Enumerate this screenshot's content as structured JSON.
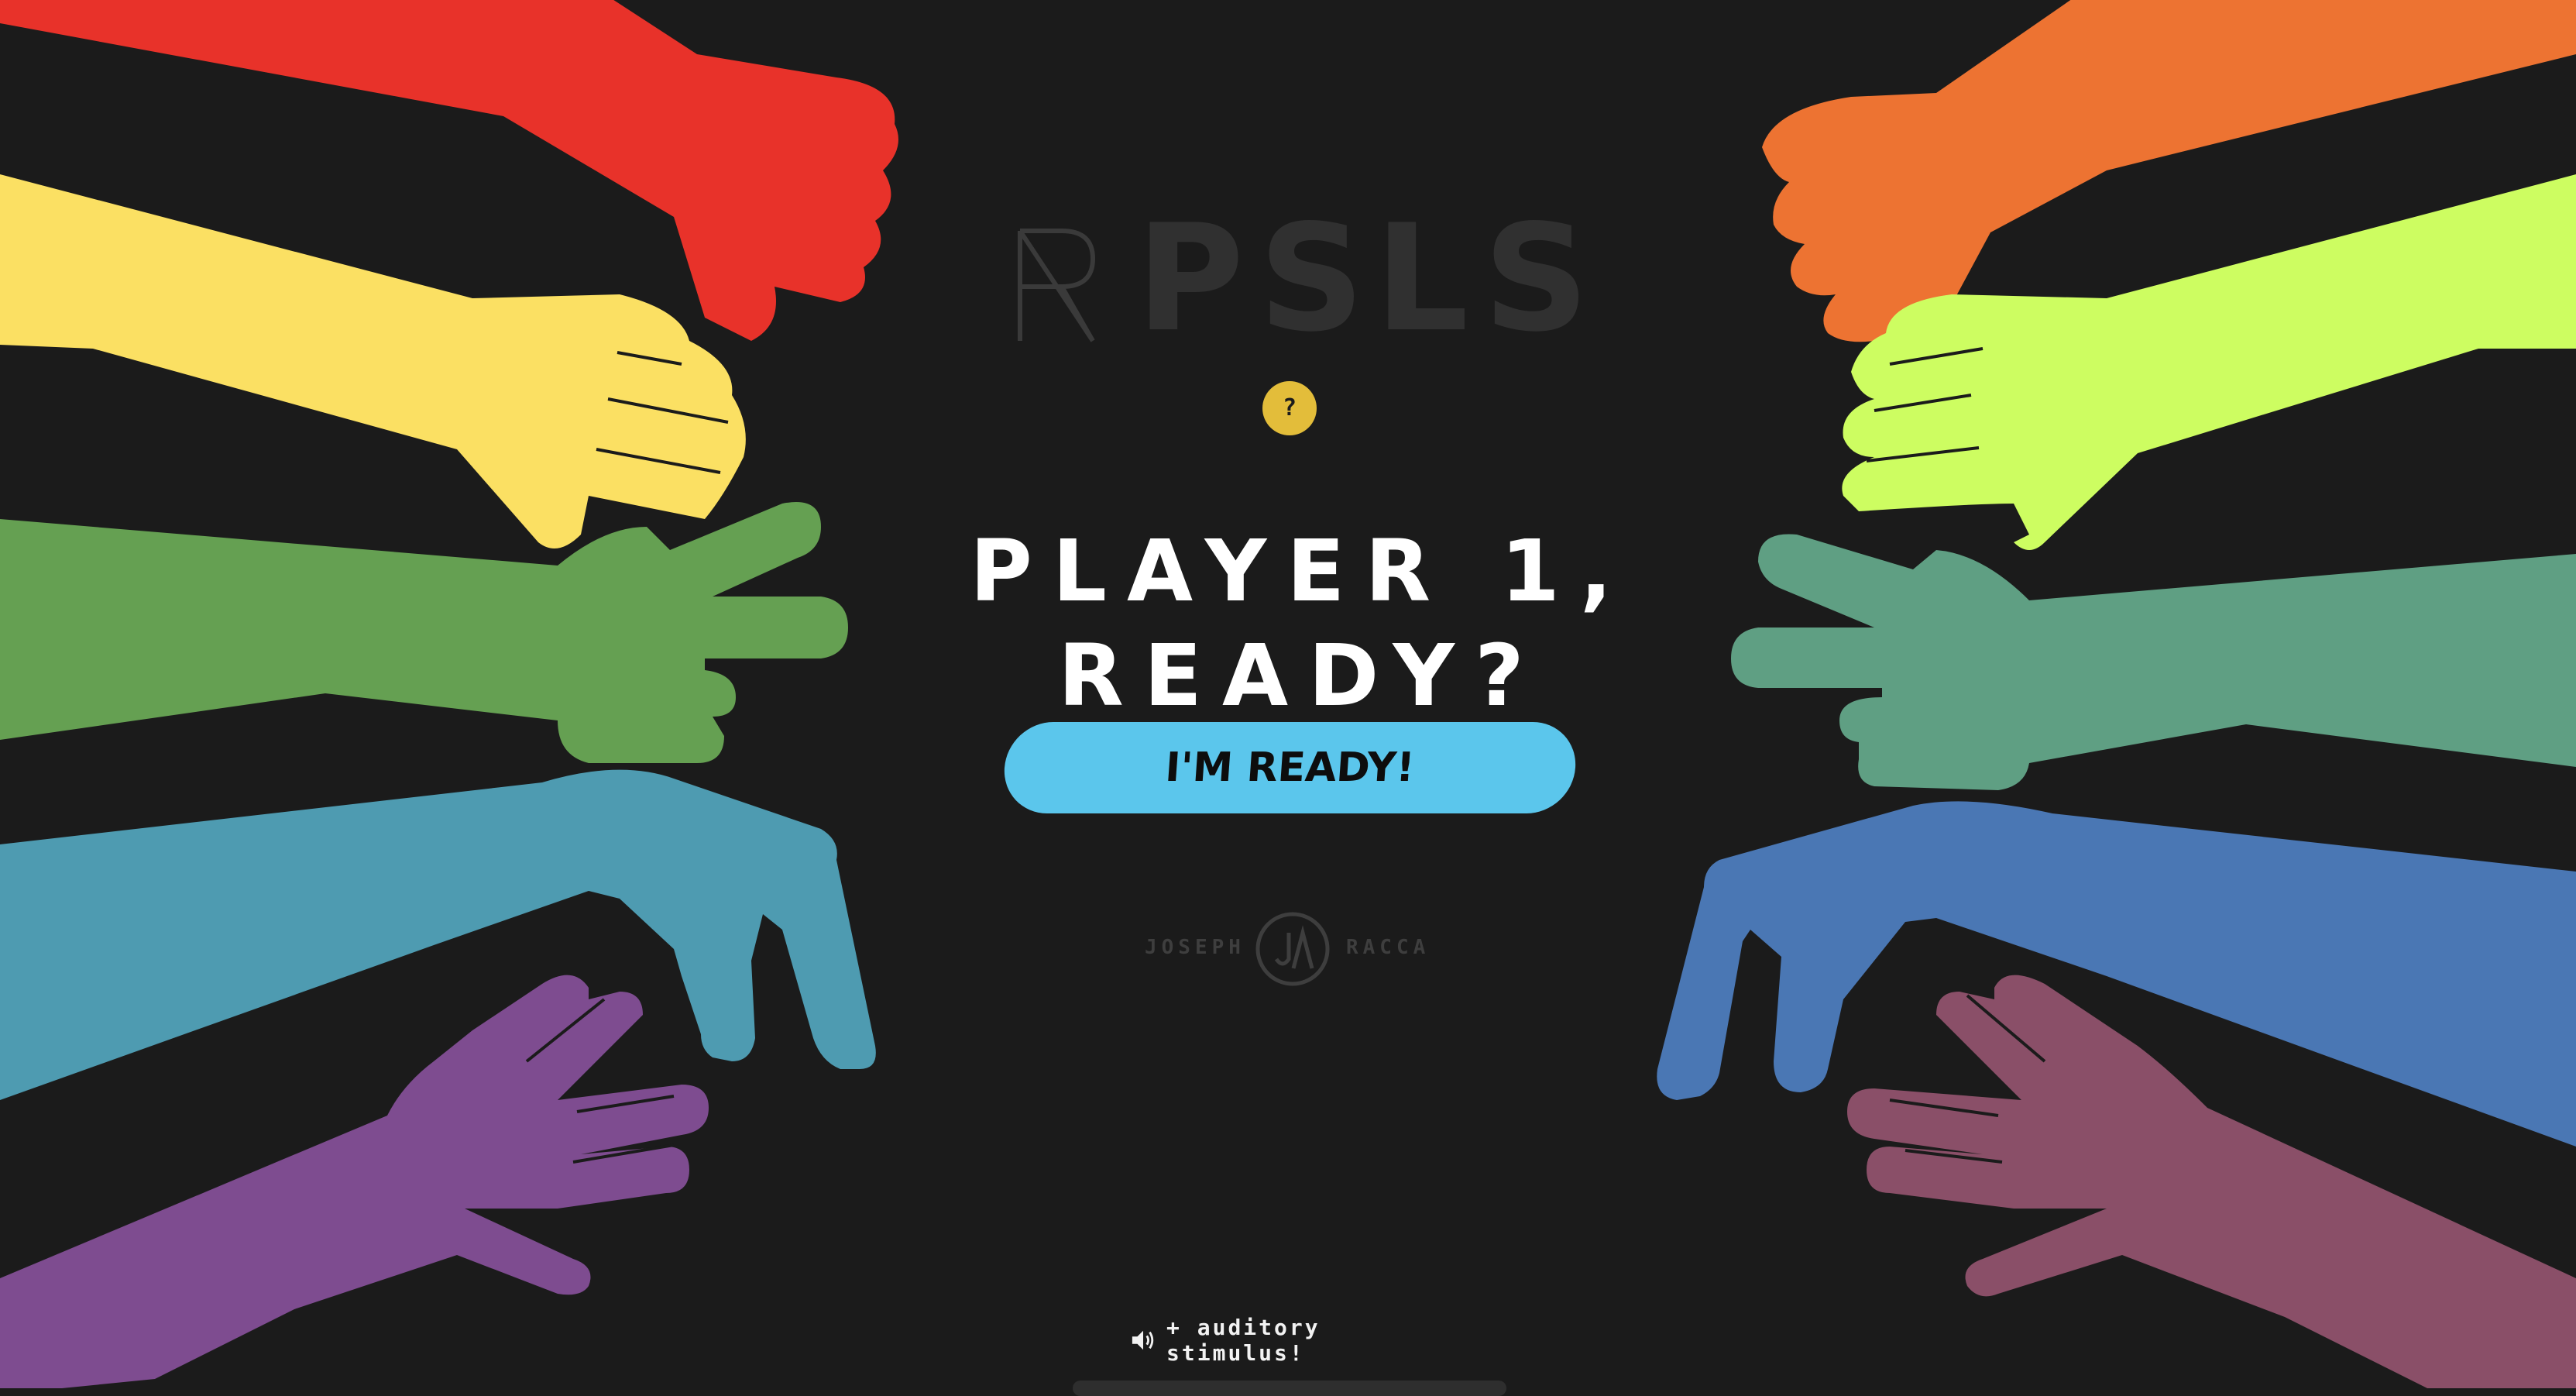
{
  "app": {
    "logo_letters": [
      "R",
      "P",
      "S",
      "L",
      "S"
    ]
  },
  "help": {
    "label": "?"
  },
  "prompt": {
    "line1": "PLAYER 1,",
    "line2": "READY?"
  },
  "ready_button": {
    "label": "I'M READY!"
  },
  "credit": {
    "first_name": "JOSEPH",
    "last_name": "RACCA"
  },
  "sound": {
    "label": "+ auditory stimulus!"
  },
  "colors": {
    "background": "#1b1b1b",
    "red": "#e8322a",
    "yellow": "#fbe063",
    "green": "#65a052",
    "teal": "#4e9bb1",
    "purple": "#7e4c90",
    "orange": "#ed7332",
    "lime": "#cdfd61",
    "seafoam": "#5f9f83",
    "blue": "#4a77b4",
    "mauve": "#8a4f68",
    "button": "#5bc6ec",
    "help": "#e3bd3a"
  }
}
